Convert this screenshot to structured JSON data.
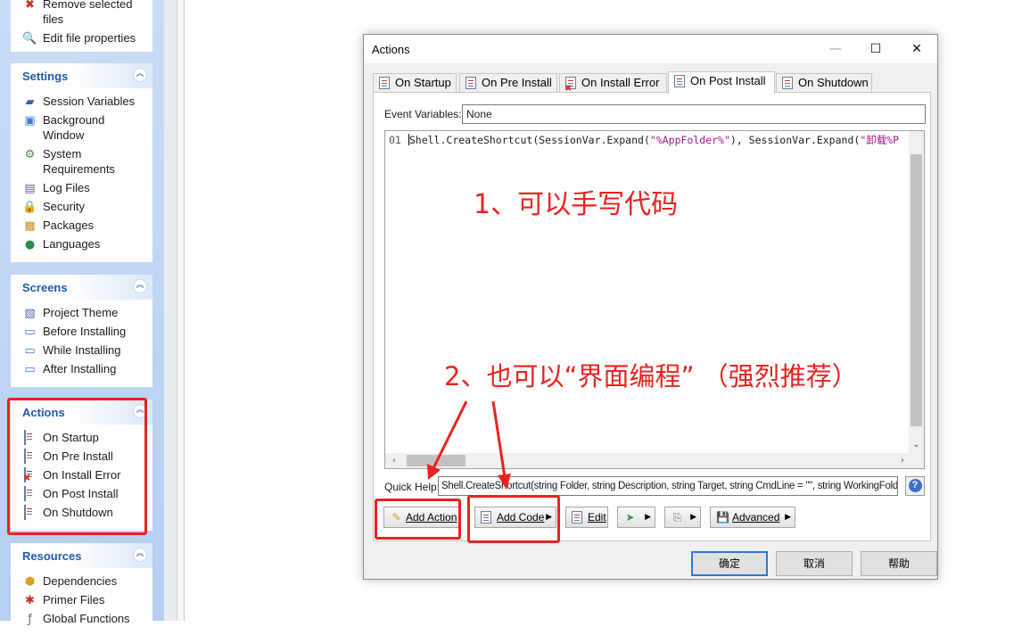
{
  "sidebar": {
    "top_items": [
      {
        "label": "Remove selected files",
        "icon": "remove-icon"
      },
      {
        "label": "Edit file properties",
        "icon": "magnifier-icon"
      }
    ],
    "settings": {
      "title": "Settings",
      "items": [
        {
          "label": "Session Variables",
          "icon": "variables-icon"
        },
        {
          "label": "Background Window",
          "icon": "window-icon"
        },
        {
          "label": "System Requirements",
          "icon": "requirements-icon"
        },
        {
          "label": "Log Files",
          "icon": "log-icon"
        },
        {
          "label": "Security",
          "icon": "lock-icon"
        },
        {
          "label": "Packages",
          "icon": "package-icon"
        },
        {
          "label": "Languages",
          "icon": "globe-icon"
        }
      ]
    },
    "screens": {
      "title": "Screens",
      "items": [
        {
          "label": "Project Theme",
          "icon": "theme-icon"
        },
        {
          "label": "Before Installing",
          "icon": "screen-icon"
        },
        {
          "label": "While Installing",
          "icon": "screen-icon"
        },
        {
          "label": "After Installing",
          "icon": "screen-icon"
        }
      ]
    },
    "actions": {
      "title": "Actions",
      "items": [
        {
          "label": "On Startup",
          "icon": "script-icon"
        },
        {
          "label": "On Pre Install",
          "icon": "script-icon"
        },
        {
          "label": "On Install Error",
          "icon": "script-error-icon"
        },
        {
          "label": "On Post Install",
          "icon": "script-icon"
        },
        {
          "label": "On Shutdown",
          "icon": "script-icon"
        }
      ]
    },
    "resources": {
      "title": "Resources",
      "items": [
        {
          "label": "Dependencies",
          "icon": "dependencies-icon"
        },
        {
          "label": "Primer Files",
          "icon": "primer-icon"
        },
        {
          "label": "Global Functions",
          "icon": "functions-icon"
        }
      ]
    }
  },
  "dialog": {
    "title": "Actions",
    "tabs": [
      {
        "label": "On Startup"
      },
      {
        "label": "On Pre Install"
      },
      {
        "label": "On Install Error"
      },
      {
        "label": "On Post Install"
      },
      {
        "label": "On Shutdown"
      }
    ],
    "active_tab": "On Post Install",
    "event_variables_label": "Event Variables:",
    "event_variables_value": "None",
    "code": {
      "line_number": "01",
      "prefix": "Shell.CreateShortcut(SessionVar.Expand(",
      "str1": "\"%AppFolder%\"",
      "middle": "), SessionVar.Expand(",
      "str2": "\"卸载%P"
    },
    "quick_help_label": "Quick Help:",
    "quick_help_value": "Shell.CreateShortcut(string Folder, string Description, string Target, string CmdLine = \"\", string WorkingFolder",
    "buttons": {
      "add_action": "Add Action",
      "add_code": "Add Code",
      "edit": "Edit",
      "advanced": "Advanced"
    },
    "footer": {
      "ok": "确定",
      "cancel": "取消",
      "help": "帮助"
    }
  },
  "annotations": {
    "note1": "1、可以手写代码",
    "note2": "2、也可以“界面编程” （强烈推荐）"
  },
  "colors": {
    "annotation_red": "#e8231f",
    "panel_title_blue": "#1f5ba8",
    "sidebar_bg": "#c8dcf6",
    "default_button_border": "#2a79d6"
  }
}
